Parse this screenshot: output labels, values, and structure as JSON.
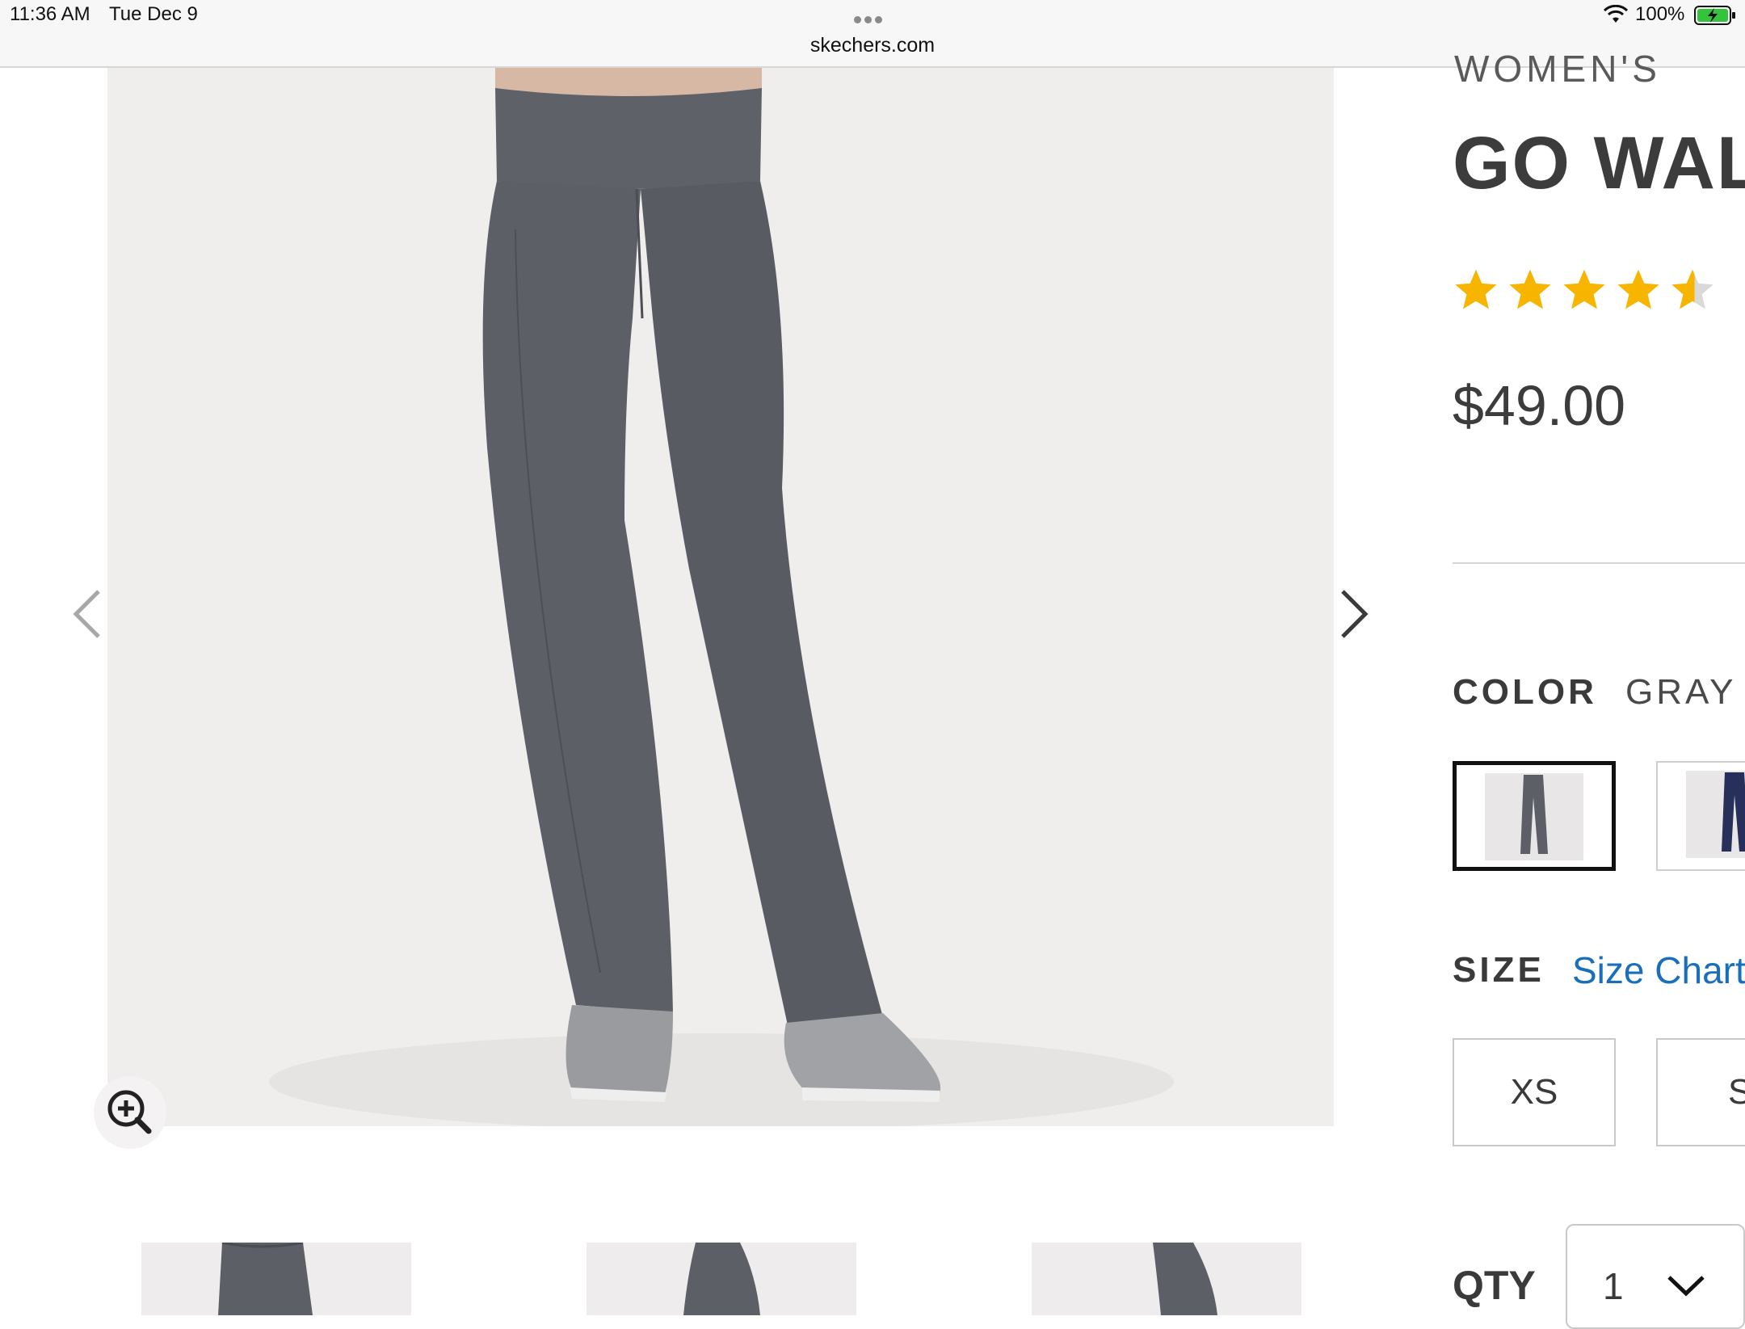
{
  "status_bar": {
    "time": "11:36 AM",
    "date": "Tue Dec 9",
    "url": "skechers.com",
    "battery": "100%"
  },
  "icons": {
    "wifi": "wifi-icon",
    "battery": "battery-charging-icon",
    "prev": "chevron-left-icon",
    "next": "chevron-right-icon",
    "zoom": "zoom-in-icon",
    "qty": "chevron-down-icon"
  },
  "product": {
    "category": "WOMEN'S",
    "title": "GO WAL",
    "rating_stars": 4.5,
    "price": "$49.00",
    "color_label": "COLOR",
    "color_value": "GRAY",
    "size_label": "SIZE",
    "size_chart_link": "Size Chart",
    "sizes": [
      "XS",
      "S"
    ],
    "qty_label": "QTY",
    "qty_value": "1"
  },
  "colors": {
    "star": "#f7b500",
    "link": "#1a6fbd",
    "pants_gray": "#5c5f66",
    "pants_navy": "#26305a"
  }
}
